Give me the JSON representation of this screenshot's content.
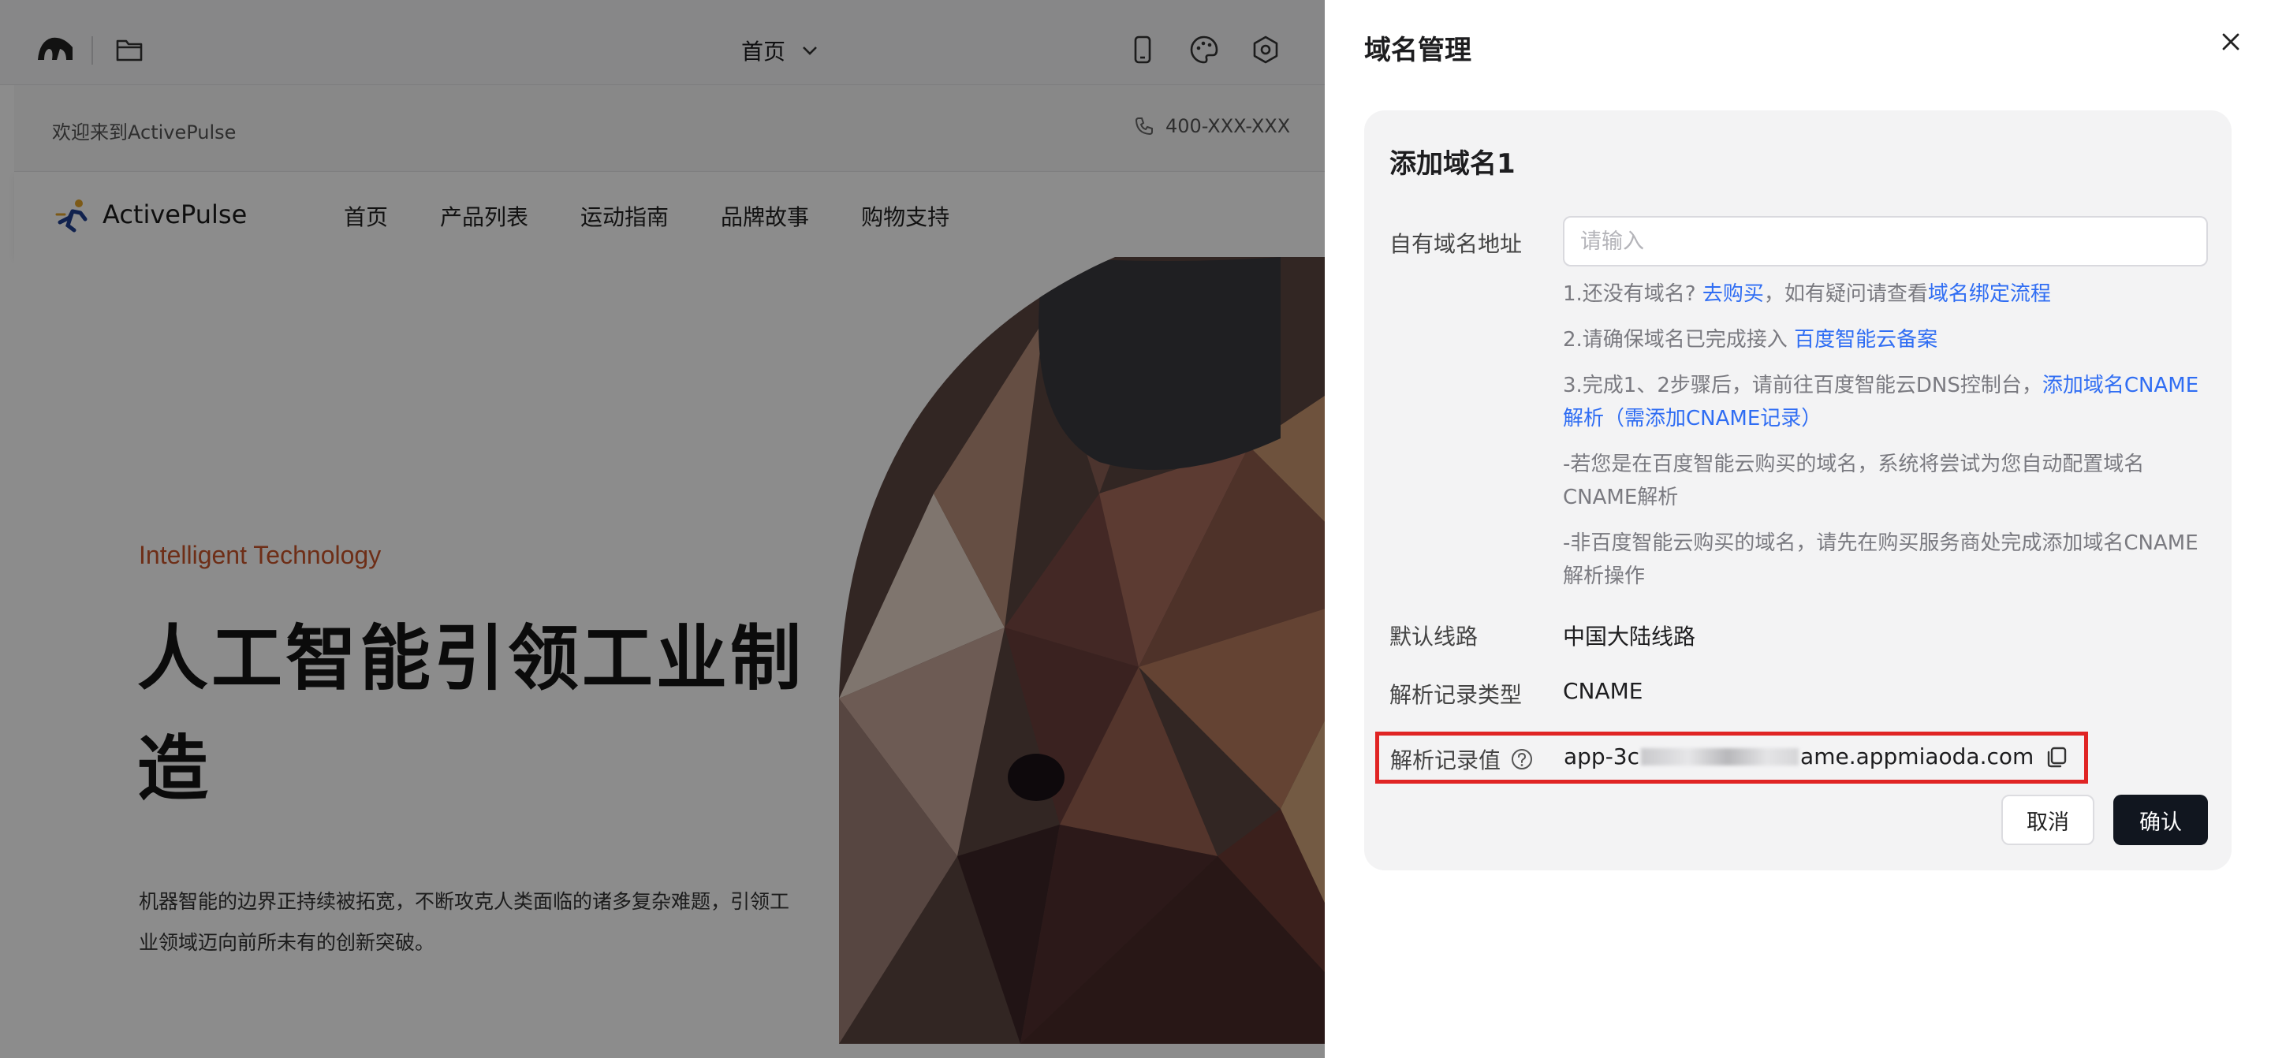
{
  "editor": {
    "page_select": "首页",
    "icons": [
      "brand-logo-icon",
      "folder-icon",
      "mobile-icon",
      "palette-icon",
      "settings-icon"
    ]
  },
  "site": {
    "welcome": "欢迎来到ActivePulse",
    "phone": "400-XXX-XXX",
    "brand": "ActivePulse",
    "nav": [
      "首页",
      "产品列表",
      "运动指南",
      "品牌故事",
      "购物支持"
    ],
    "hero": {
      "eyebrow": "Intelligent Technology",
      "headline": "人工智能引领工业制造",
      "desc": "机器智能的边界正持续被拓宽，不断攻克人类面临的诸多复杂难题，引领工业领域迈向前所未有的创新突破。"
    }
  },
  "drawer": {
    "title": "域名管理",
    "card_title": "添加域名1",
    "domain_label": "自有域名地址",
    "domain_placeholder": "请输入",
    "domain_value": "",
    "notes": {
      "n1_prefix": "1.还没有域名?",
      "n1_link1": "去购买",
      "n1_mid": "，如有疑问请查看",
      "n1_link2": "域名绑定流程",
      "n2_prefix": "2.请确保域名已完成接入",
      "n2_link": "百度智能云备案",
      "n3_prefix": "3.完成1、2步骤后，请前往百度智能云DNS控制台，",
      "n3_link": "添加域名CNAME解析（需添加CNAME记录）",
      "n4": "-若您是在百度智能云购买的域名，系统将尝试为您自动配置域名CNAME解析",
      "n5": "-非百度智能云购买的域名，请先在购买服务商处完成添加域名CNAME解析操作"
    },
    "line_label": "默认线路",
    "line_value": "中国大陆线路",
    "type_label": "解析记录类型",
    "type_value": "CNAME",
    "record_label": "解析记录值",
    "record_prefix": "app-3c",
    "record_suffix": "ame.appmiaoda.com",
    "cancel": "取消",
    "confirm": "确认"
  },
  "colors": {
    "link": "#2f6df3",
    "highlight": "#e02424",
    "primary_btn": "#11161f",
    "accent": "#c8552a"
  }
}
